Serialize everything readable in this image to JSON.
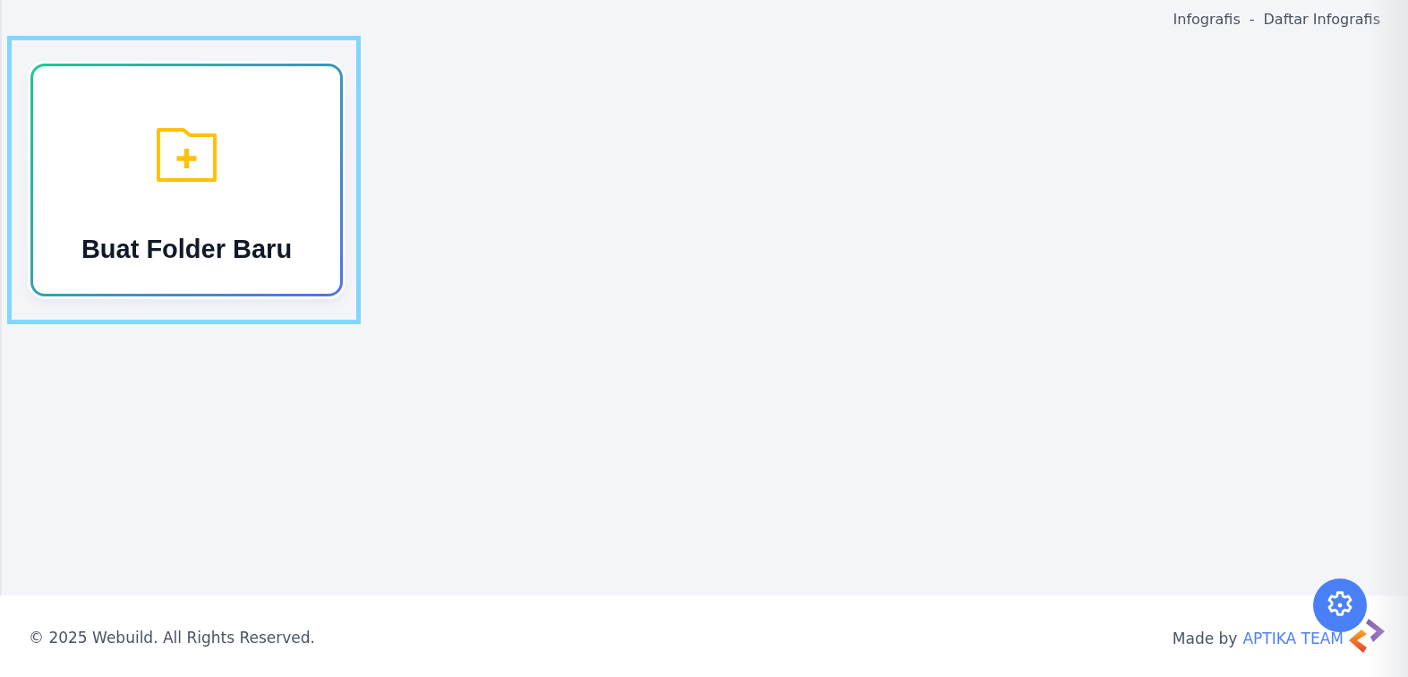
{
  "breadcrumb": {
    "items": [
      "Infografis",
      "Daftar Infografis"
    ],
    "separator": "-"
  },
  "cards": [
    {
      "title": "Buat Folder Baru",
      "highlighted": true
    }
  ],
  "footer": {
    "copyright": "© 2025 Webuild. All Rights Reserved.",
    "made_by": "Made by",
    "team_link": "APTIKA TEAM"
  }
}
